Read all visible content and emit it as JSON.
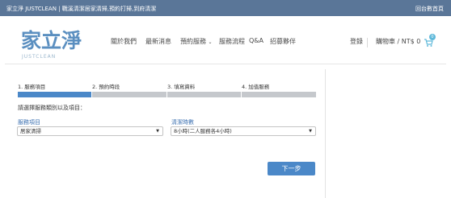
{
  "topbar": {
    "left_text": "家立淨 JUSTCLEAN | 戰溪清潔居家清掃,預約打掃,到府清潔",
    "right_text": "回台數首頁"
  },
  "logo": {
    "text": "家立淨",
    "sub": "JUSTCLEAN",
    "colors": {
      "main": "#5b8fc0",
      "accent": "#63b7d9"
    }
  },
  "nav": {
    "items": [
      {
        "label": "關於我們"
      },
      {
        "label": "最新消息"
      },
      {
        "label": "預約服務"
      },
      {
        "label": "服務流程"
      },
      {
        "label": "Q&A"
      },
      {
        "label": "招募夥伴"
      }
    ],
    "dropdown_icon": "chevron-down-icon"
  },
  "account": {
    "login_label": "登錄",
    "cart_label": "購物車 / NT$ 0",
    "cart_count": "0",
    "cart_icon": "cart-icon"
  },
  "steps": [
    {
      "label": "1. 服務項目",
      "active": true
    },
    {
      "label": "2. 預約時段",
      "active": false
    },
    {
      "label": "3. 填寫資料",
      "active": false
    },
    {
      "label": "4. 加值服務",
      "active": false
    }
  ],
  "colors": {
    "topbar": "#5a7698",
    "step_active": "#4b88c8",
    "step_inactive": "#c5c8cc",
    "button": "#4b88c8",
    "label_blue": "#3a6fb0"
  },
  "form": {
    "instruction": "請選擇服務類別以及項目：",
    "category_label": "服務項目",
    "category_value": "居家清掃",
    "duration_label": "清潔時數",
    "duration_value": "8小時(二人服務各4小時)",
    "select_icon": "select-arrow-icon"
  },
  "buttons": {
    "next": "下一步"
  }
}
